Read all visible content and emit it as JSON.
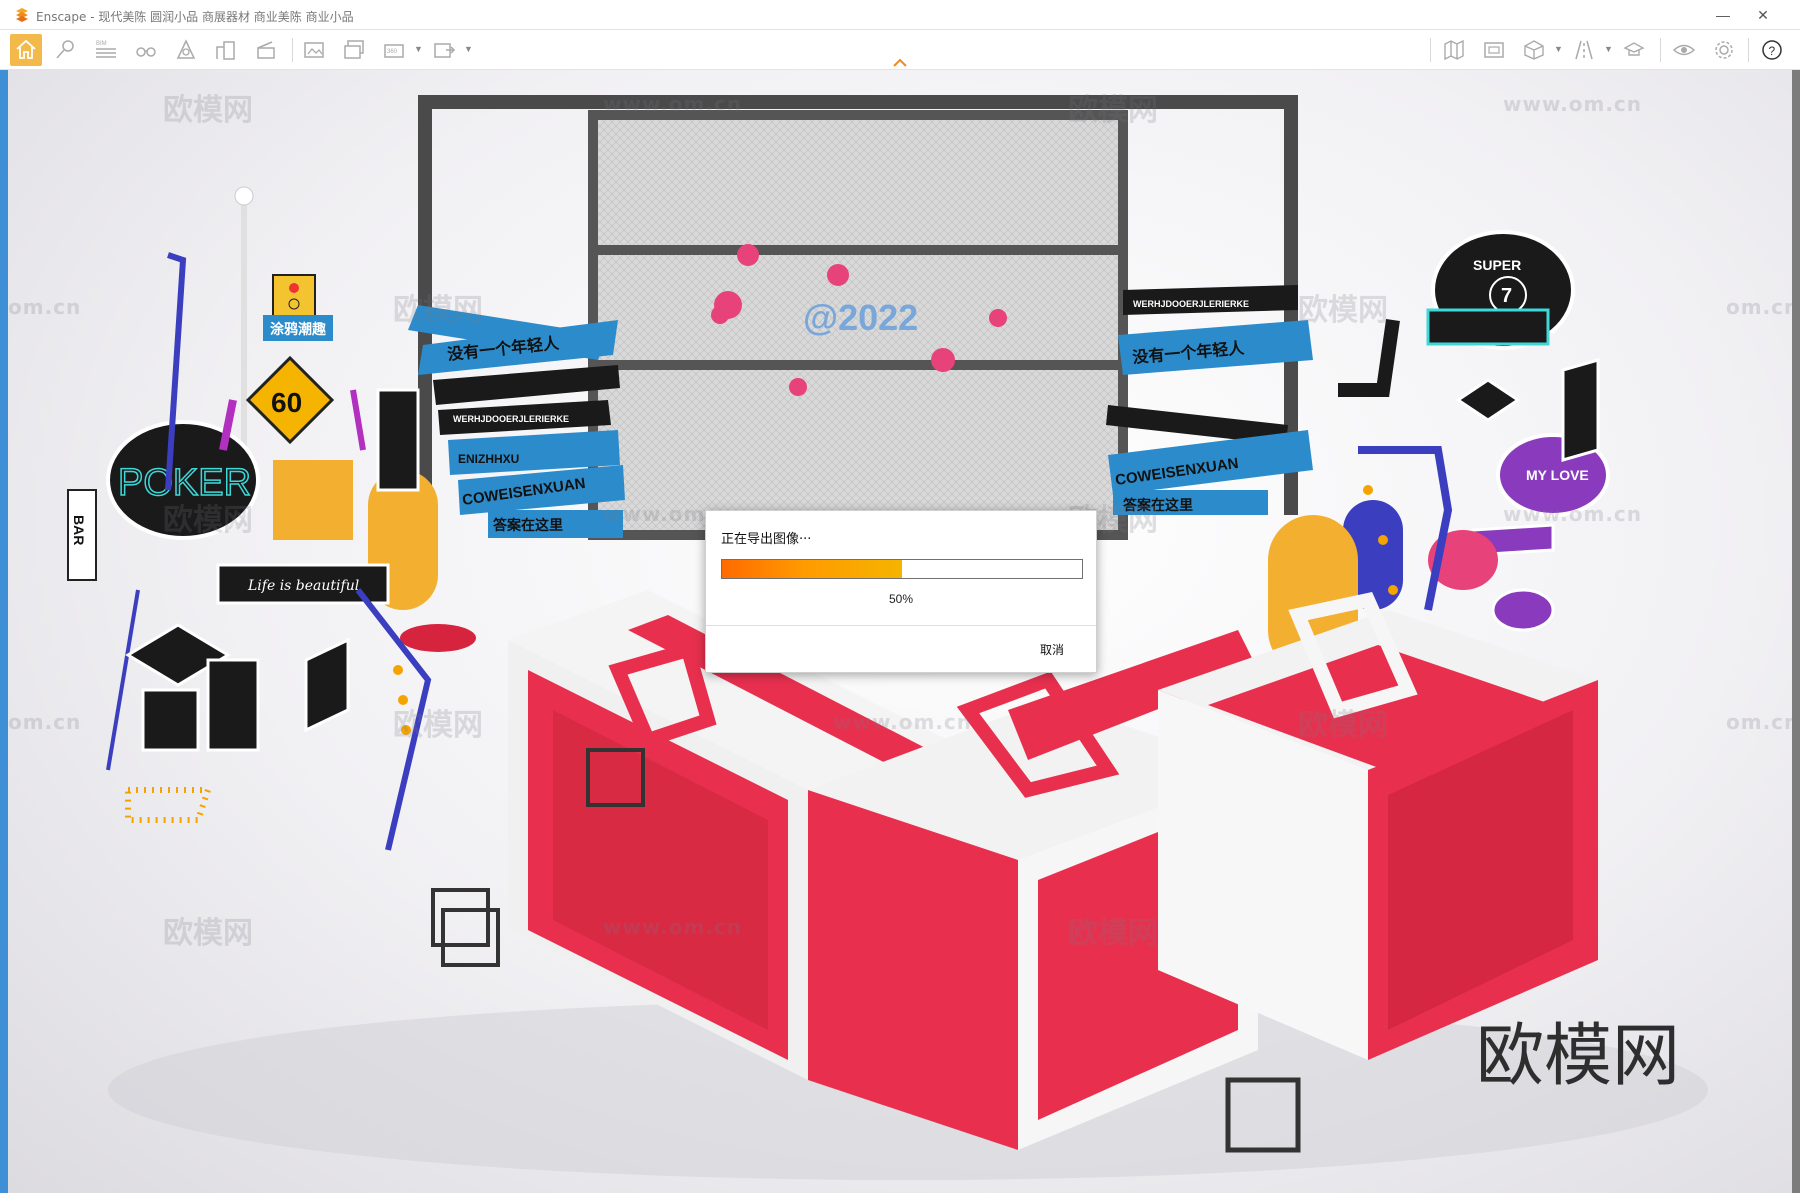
{
  "window": {
    "title": "Enscape - 现代美陈 圆润小品 商展器材 商业美陈 商业小品",
    "minimize": "—",
    "maximize": "☐",
    "close": "✕"
  },
  "toolbar": {
    "left_icons": [
      "home-icon",
      "pin-icon",
      "bim-icon",
      "binoculars-icon",
      "cone-icon",
      "buildings-icon",
      "clapper-icon",
      "screenshot-icon",
      "batch-render-icon",
      "panorama-icon",
      "exe-export-icon"
    ],
    "right_icons": [
      "map-icon",
      "frame-icon",
      "cube-icon",
      "road-icon",
      "hat-icon",
      "eye-icon",
      "gear-icon",
      "help-icon"
    ],
    "accent": "#f3b94a"
  },
  "watermarks": {
    "brand": "欧模网",
    "url": "www.om.cn",
    "partial_url": "om.cn"
  },
  "scene": {
    "sign_left_1": "没有一个年轻人",
    "sign_left_2": "WERHJDOOERJLERIERKE",
    "sign_left_3": "ENIZHHXU",
    "sign_left_4": "COWEISENXUAN",
    "sign_left_5": "答案在这里",
    "sign_right_1": "没有一个年轻人",
    "sign_right_2": "WERHJDOOERJLERIERKE",
    "sign_right_3": "COWEISENXUAN",
    "sign_right_4": "答案在这里",
    "sign_poker": "POKER",
    "sign_bar": "BAR",
    "sign_life": "Life is beautiful",
    "sign_60": "60",
    "sign_graffiti": "涂鸦潮趣",
    "sign_super": "SUPER",
    "sign_super_num": "7",
    "sign_mylove": "MY LOVE",
    "sign_year": "@2022"
  },
  "dialog": {
    "title": "正在导出图像···",
    "progress": 0.5,
    "progress_label": "50%",
    "cancel": "取消"
  }
}
